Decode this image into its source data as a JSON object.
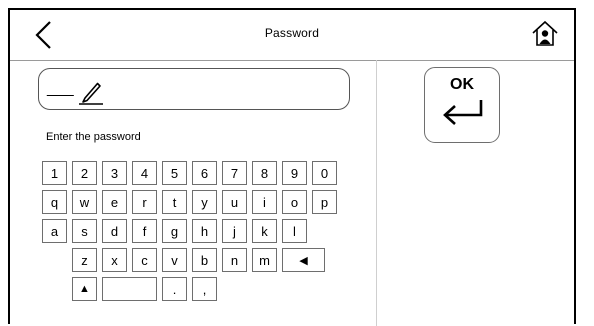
{
  "header": {
    "title": "Password",
    "back_icon": "chevron-left-icon",
    "home_icon": "home-icon"
  },
  "password": {
    "value": "___",
    "edit_icon": "pencil-icon"
  },
  "prompt": "Enter the password",
  "keyboard": {
    "rows": [
      [
        "1",
        "2",
        "3",
        "4",
        "5",
        "6",
        "7",
        "8",
        "9",
        "0"
      ],
      [
        "q",
        "w",
        "e",
        "r",
        "t",
        "y",
        "u",
        "i",
        "o",
        "p"
      ],
      [
        "a",
        "s",
        "d",
        "f",
        "g",
        "h",
        "j",
        "k",
        "l"
      ],
      [
        "z",
        "x",
        "c",
        "v",
        "b",
        "n",
        "m",
        "◀"
      ],
      [
        "▲",
        "",
        ".",
        ","
      ]
    ]
  },
  "ok_button": {
    "label": "OK",
    "icon": "enter-icon"
  }
}
